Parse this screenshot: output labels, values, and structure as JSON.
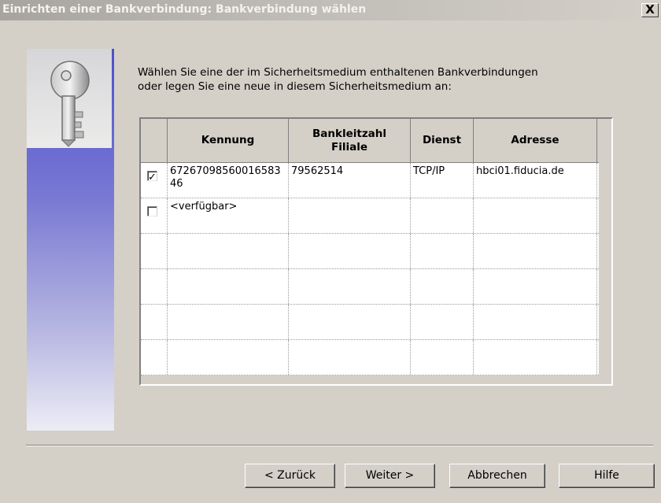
{
  "window": {
    "title": "Einrichten einer Bankverbindung: Bankverbindung wählen",
    "close_label": "X"
  },
  "instruction": {
    "line1": "Wählen Sie eine der im Sicherheitsmedium enthaltenen Bankverbindungen",
    "line2": "oder legen Sie eine neue in diesem Sicherheitsmedium an:"
  },
  "table": {
    "headers": {
      "kennung": "Kennung",
      "blz_line1": "Bankleitzahl",
      "blz_line2": "Filiale",
      "dienst": "Dienst",
      "adresse": "Adresse"
    },
    "rows": [
      {
        "checked": true,
        "check_mark": "✓",
        "kennung": "6726709856001658346",
        "blz": "79562514",
        "dienst": "TCP/IP",
        "adresse": "hbci01.fiducia.de"
      },
      {
        "checked": false,
        "check_mark": "",
        "kennung": "<verfügbar>",
        "blz": "",
        "dienst": "",
        "adresse": ""
      },
      {
        "checked": false,
        "kennung": "",
        "blz": "",
        "dienst": "",
        "adresse": ""
      },
      {
        "checked": false,
        "kennung": "",
        "blz": "",
        "dienst": "",
        "adresse": ""
      },
      {
        "checked": false,
        "kennung": "",
        "blz": "",
        "dienst": "",
        "adresse": ""
      },
      {
        "checked": false,
        "kennung": "",
        "blz": "",
        "dienst": "",
        "adresse": ""
      }
    ]
  },
  "buttons": {
    "back": "< Zurück",
    "next": "Weiter >",
    "cancel": "Abbrechen",
    "help": "Hilfe"
  },
  "icons": {
    "sidebar": "key-icon"
  }
}
